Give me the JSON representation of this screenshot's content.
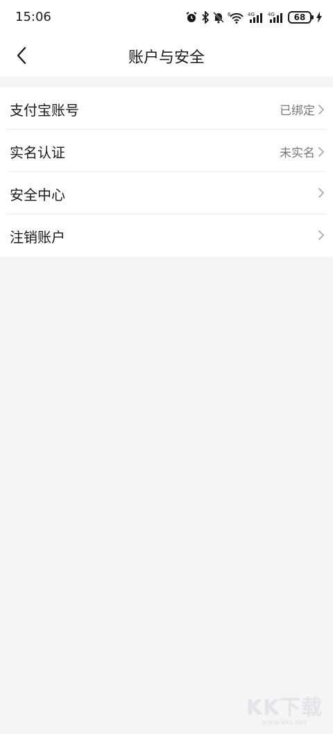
{
  "status_bar": {
    "time": "15:06",
    "icons": [
      "alarm-icon",
      "bluetooth-icon",
      "mute-icon",
      "wifi-icon",
      "signal-4g-icon",
      "signal-4g-icon"
    ],
    "wifi_badge": "6",
    "network_1": "4G",
    "network_2": "4G",
    "battery": "68"
  },
  "nav": {
    "title": "账户与安全",
    "back_icon": "chevron-left-icon"
  },
  "settings": [
    {
      "label": "支付宝账号",
      "value": "已绑定"
    },
    {
      "label": "实名认证",
      "value": "未实名"
    },
    {
      "label": "安全中心",
      "value": ""
    },
    {
      "label": "注销账户",
      "value": ""
    }
  ],
  "watermark": {
    "brand": "KK下载",
    "url": "www.kkx.net"
  },
  "colors": {
    "page_background": "#f4f5f7",
    "card_background": "#ffffff",
    "text_primary": "#1a1a1a",
    "text_secondary": "#777777"
  }
}
